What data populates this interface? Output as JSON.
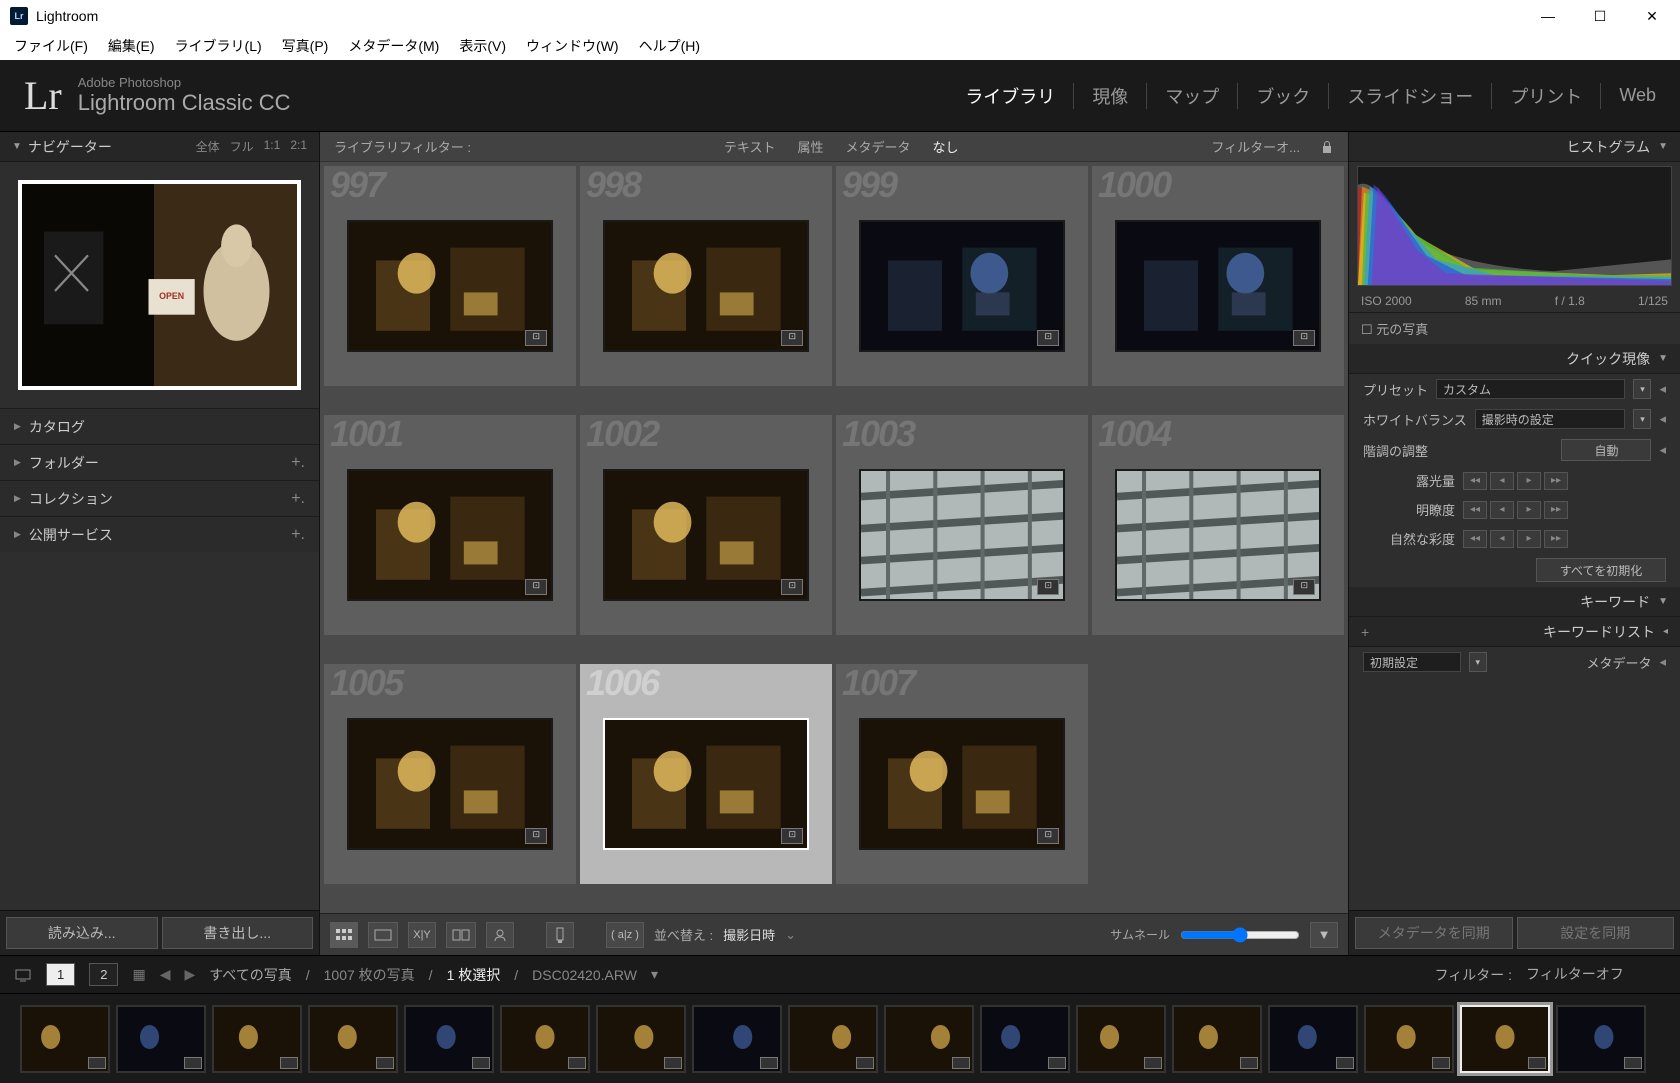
{
  "window": {
    "title": "Lightroom"
  },
  "menu": [
    "ファイル(F)",
    "編集(E)",
    "ライブラリ(L)",
    "写真(P)",
    "メタデータ(M)",
    "表示(V)",
    "ウィンドウ(W)",
    "ヘルプ(H)"
  ],
  "brand": {
    "suite": "Adobe Photoshop",
    "product": "Lightroom Classic CC"
  },
  "modules": [
    {
      "label": "ライブラリ",
      "active": true
    },
    {
      "label": "現像"
    },
    {
      "label": "マップ"
    },
    {
      "label": "ブック"
    },
    {
      "label": "スライドショー"
    },
    {
      "label": "プリント"
    },
    {
      "label": "Web"
    }
  ],
  "navigator": {
    "title": "ナビゲーター",
    "zoom": [
      "全体",
      "フル",
      "1:1",
      "2:1"
    ]
  },
  "left_sections": [
    "カタログ",
    "フォルダー",
    "コレクション",
    "公開サービス"
  ],
  "left_buttons": {
    "import": "読み込み...",
    "export": "書き出し..."
  },
  "filterbar": {
    "label": "ライブラリフィルター :",
    "items": [
      "テキスト",
      "属性",
      "メタデータ",
      "なし"
    ],
    "active": "なし",
    "preset": "フィルターオ..."
  },
  "grid_items": [
    {
      "n": "997"
    },
    {
      "n": "998"
    },
    {
      "n": "999"
    },
    {
      "n": "1000"
    },
    {
      "n": "1001"
    },
    {
      "n": "1002"
    },
    {
      "n": "1003"
    },
    {
      "n": "1004"
    },
    {
      "n": "1005"
    },
    {
      "n": "1006",
      "sel": true
    },
    {
      "n": "1007"
    }
  ],
  "toolbar": {
    "sort_label": "並べ替え :",
    "sort_value": "撮影日時",
    "thumb_size": "サムネール"
  },
  "histogram": {
    "title": "ヒストグラム",
    "iso": "ISO 2000",
    "focal": "85 mm",
    "aperture": "f / 1.8",
    "shutter": "1/125",
    "original": "元の写真"
  },
  "quickdev": {
    "title": "クイック現像",
    "preset_label": "プリセット",
    "preset_value": "カスタム",
    "wb_label": "ホワイトバランス",
    "wb_value": "撮影時の設定",
    "tone_label": "階調の調整",
    "auto": "自動",
    "exposure": "露光量",
    "clarity": "明瞭度",
    "vibrance": "自然な彩度",
    "reset": "すべてを初期化"
  },
  "keyword": {
    "title": "キーワード",
    "list": "キーワードリスト"
  },
  "metadata": {
    "preset": "初期設定",
    "label": "メタデータ"
  },
  "right_buttons": {
    "sync_meta": "メタデータを同期",
    "sync_settings": "設定を同期"
  },
  "status": {
    "collection": "すべての写真",
    "count": "1007 枚の写真",
    "selected": "1 枚選択",
    "file": "DSC02420.ARW",
    "filter_label": "フィルター :",
    "filter_value": "フィルターオフ"
  },
  "filmstrip_count": 17,
  "filmstrip_selected": 15
}
